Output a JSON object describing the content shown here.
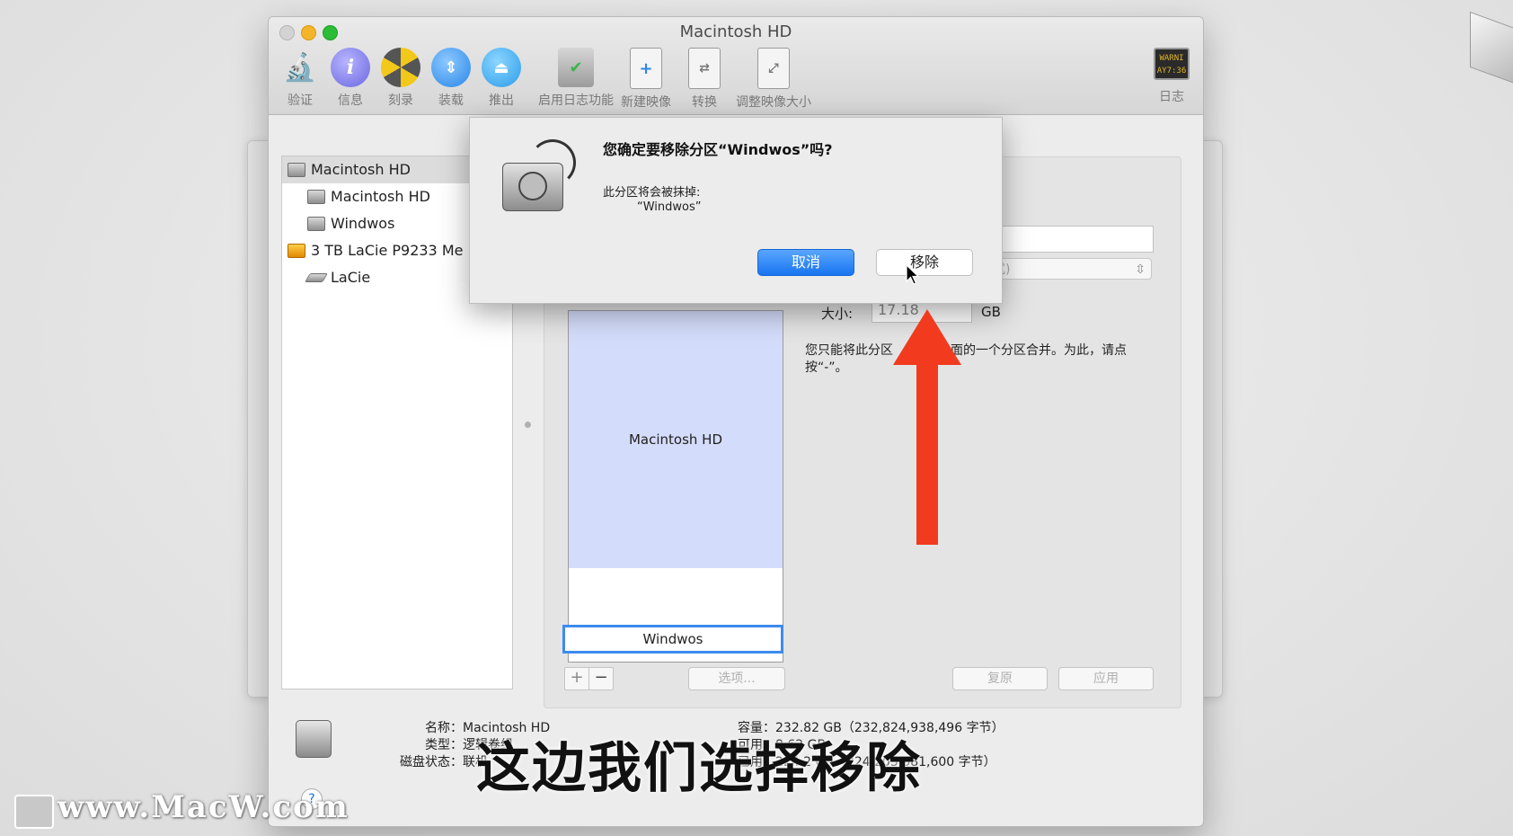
{
  "window": {
    "title": "Macintosh HD",
    "toolbar": [
      {
        "label": "验证",
        "icon": "microscope-icon"
      },
      {
        "label": "信息",
        "icon": "info-icon"
      },
      {
        "label": "刻录",
        "icon": "burn-icon"
      },
      {
        "label": "装载",
        "icon": "mount-icon"
      },
      {
        "label": "推出",
        "icon": "eject-icon"
      },
      {
        "label": "启用日志功能",
        "icon": "journal-icon"
      },
      {
        "label": "新建映像",
        "icon": "new-image-icon"
      },
      {
        "label": "转换",
        "icon": "convert-icon"
      },
      {
        "label": "调整映像大小",
        "icon": "resize-image-icon"
      },
      {
        "label": "日志",
        "icon": "log-icon"
      }
    ],
    "log_icon_text": [
      "WARNI",
      "AY7:36"
    ]
  },
  "sidebar": {
    "items": [
      {
        "label": "Macintosh HD"
      },
      {
        "label": "Macintosh HD"
      },
      {
        "label": "Windwos"
      },
      {
        "label": "3 TB LaCie P9233 Me"
      },
      {
        "label": "LaCie"
      }
    ]
  },
  "partition": {
    "size_label": "大小:",
    "size_value": "17.18",
    "size_unit": "GB",
    "format_value": "志式)",
    "info_text_1": "您只能将此分区",
    "info_text_2": "面的一个分区合并。为此，请点",
    "info_text_3": "按“-”。",
    "blocks": [
      {
        "label": "Macintosh HD"
      },
      {
        "label": "Windwos"
      }
    ],
    "add_button": "+",
    "remove_button": "−",
    "options_button": "选项...",
    "revert_button": "复原",
    "apply_button": "应用"
  },
  "dialog": {
    "title": "您确定要移除分区“Windwos”吗?",
    "message": "此分区将会被抹掉:",
    "partition_name": "“Windwos”",
    "cancel_label": "取消",
    "remove_label": "移除"
  },
  "footer": {
    "name_label": "名称：",
    "name_value": "Macintosh HD",
    "type_label": "类型：",
    "type_value": "逻辑卷组",
    "status_label": "磁盘状态：",
    "status_value": "联机",
    "capacity_label": "容量：",
    "capacity_value": "232.82 GB（232,824,938,496 字节）",
    "line2": "可用：8.62 GB",
    "line3": "已用：224.2 GB（224,205,081,600 字节）",
    "help": "?"
  },
  "subtitle": "这边我们选择移除",
  "watermark": "www.MacW.com",
  "annotation": {
    "color": "#f23a1f"
  }
}
